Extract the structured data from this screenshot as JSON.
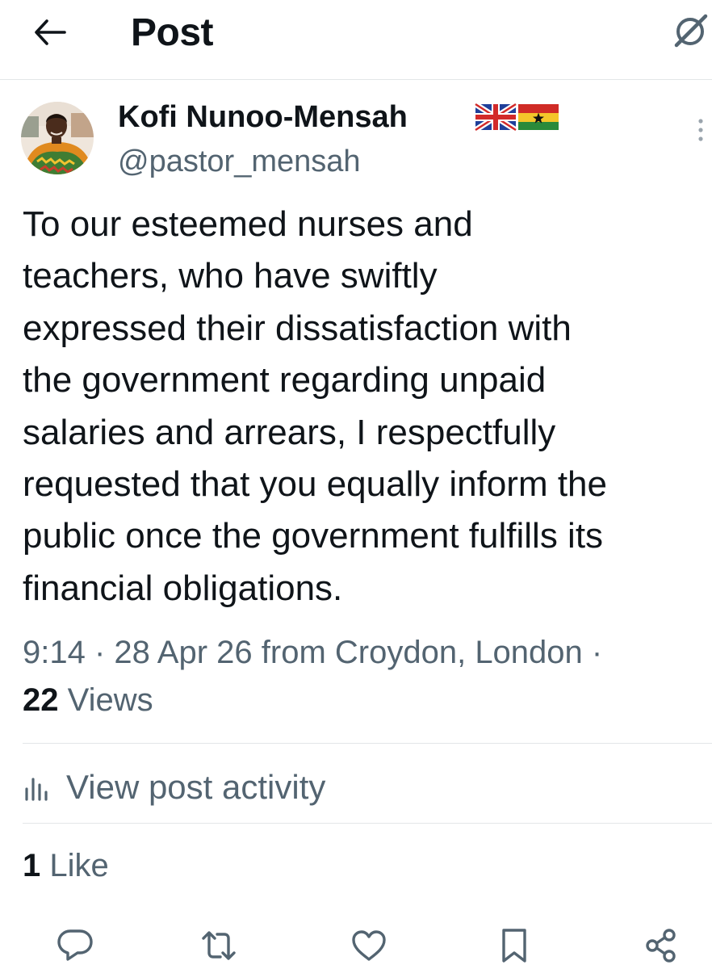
{
  "header": {
    "title": "Post",
    "back_icon": "arrow-left-icon",
    "grok_icon": "grok-icon"
  },
  "author": {
    "name": "Kofi Nunoo-Mensah",
    "handle": "@pastor_mensah",
    "flags": [
      "flag-uk-icon",
      "flag-ghana-icon"
    ],
    "more_icon": "more-vertical-icon"
  },
  "post": {
    "lines": [
      "To our esteemed nurses and",
      "teachers, who have swiftly",
      "expressed their dissatisfaction with",
      "the government regarding unpaid",
      "salaries and arrears, I respectfully",
      "requested that you equally inform the",
      "public once the government fulfills its",
      "financial obligations."
    ]
  },
  "meta": {
    "time": "9:14",
    "separator": " · ",
    "date": "28 Apr 26",
    "location": "from Croydon, London",
    "trailing_separator": " ·",
    "views_count": "22",
    "views_label": " Views"
  },
  "activity": {
    "label": "View post activity",
    "icon": "analytics-icon"
  },
  "likes": {
    "count": "1",
    "label": " Like"
  },
  "actions": [
    {
      "icon": "reply-icon"
    },
    {
      "icon": "repost-icon"
    },
    {
      "icon": "like-icon"
    },
    {
      "icon": "bookmark-icon"
    },
    {
      "icon": "share-icon"
    }
  ],
  "colors": {
    "text_primary": "#0f1419",
    "text_secondary": "#536471",
    "divider": "#e3e6e8"
  }
}
